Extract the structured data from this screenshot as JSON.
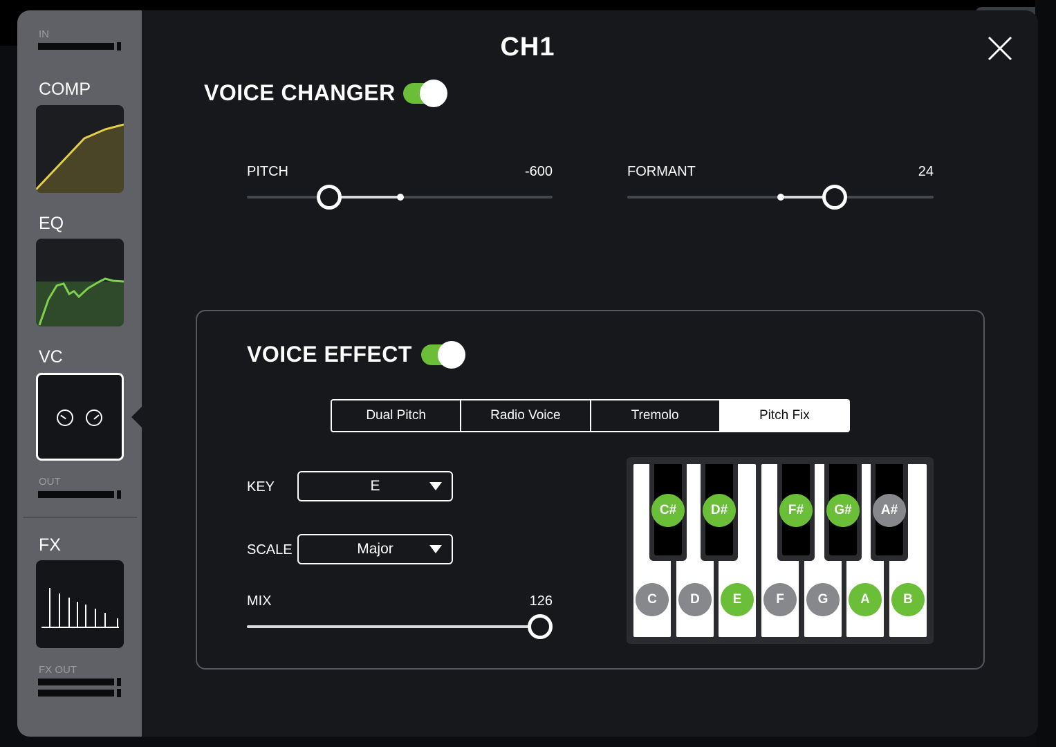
{
  "colors": {
    "accent": "#6bbe38",
    "inactive_note": "#86888c",
    "background": "#17181c",
    "sidebar": "#5f6166"
  },
  "sidebar": {
    "in_label": "IN",
    "comp_label": "COMP",
    "eq_label": "EQ",
    "vc_label": "VC",
    "out_label": "OUT",
    "fx_label": "FX",
    "fx_out_label": "FX OUT"
  },
  "header": {
    "title": "CH1",
    "close_icon": "close-icon"
  },
  "voice_changer": {
    "title": "VOICE CHANGER",
    "enabled": true,
    "pitch": {
      "label": "PITCH",
      "value": "-600"
    },
    "formant": {
      "label": "FORMANT",
      "value": "24"
    }
  },
  "voice_effect": {
    "title": "VOICE EFFECT",
    "enabled": true,
    "tabs": [
      {
        "label": "Dual Pitch",
        "active": false
      },
      {
        "label": "Radio Voice",
        "active": false
      },
      {
        "label": "Tremolo",
        "active": false
      },
      {
        "label": "Pitch Fix",
        "active": true
      }
    ],
    "key": {
      "label": "KEY",
      "value": "E"
    },
    "scale": {
      "label": "SCALE",
      "value": "Major"
    },
    "mix": {
      "label": "MIX",
      "value": "126"
    },
    "piano": {
      "white_keys": [
        {
          "note": "C",
          "in_scale": false
        },
        {
          "note": "D",
          "in_scale": false
        },
        {
          "note": "E",
          "in_scale": true
        },
        {
          "note": "F",
          "in_scale": false
        },
        {
          "note": "G",
          "in_scale": false
        },
        {
          "note": "A",
          "in_scale": true
        },
        {
          "note": "B",
          "in_scale": true
        }
      ],
      "black_keys": [
        {
          "note": "C#",
          "in_scale": true
        },
        {
          "note": "D#",
          "in_scale": true
        },
        {
          "note": "F#",
          "in_scale": true
        },
        {
          "note": "G#",
          "in_scale": true
        },
        {
          "note": "A#",
          "in_scale": false
        }
      ]
    }
  }
}
